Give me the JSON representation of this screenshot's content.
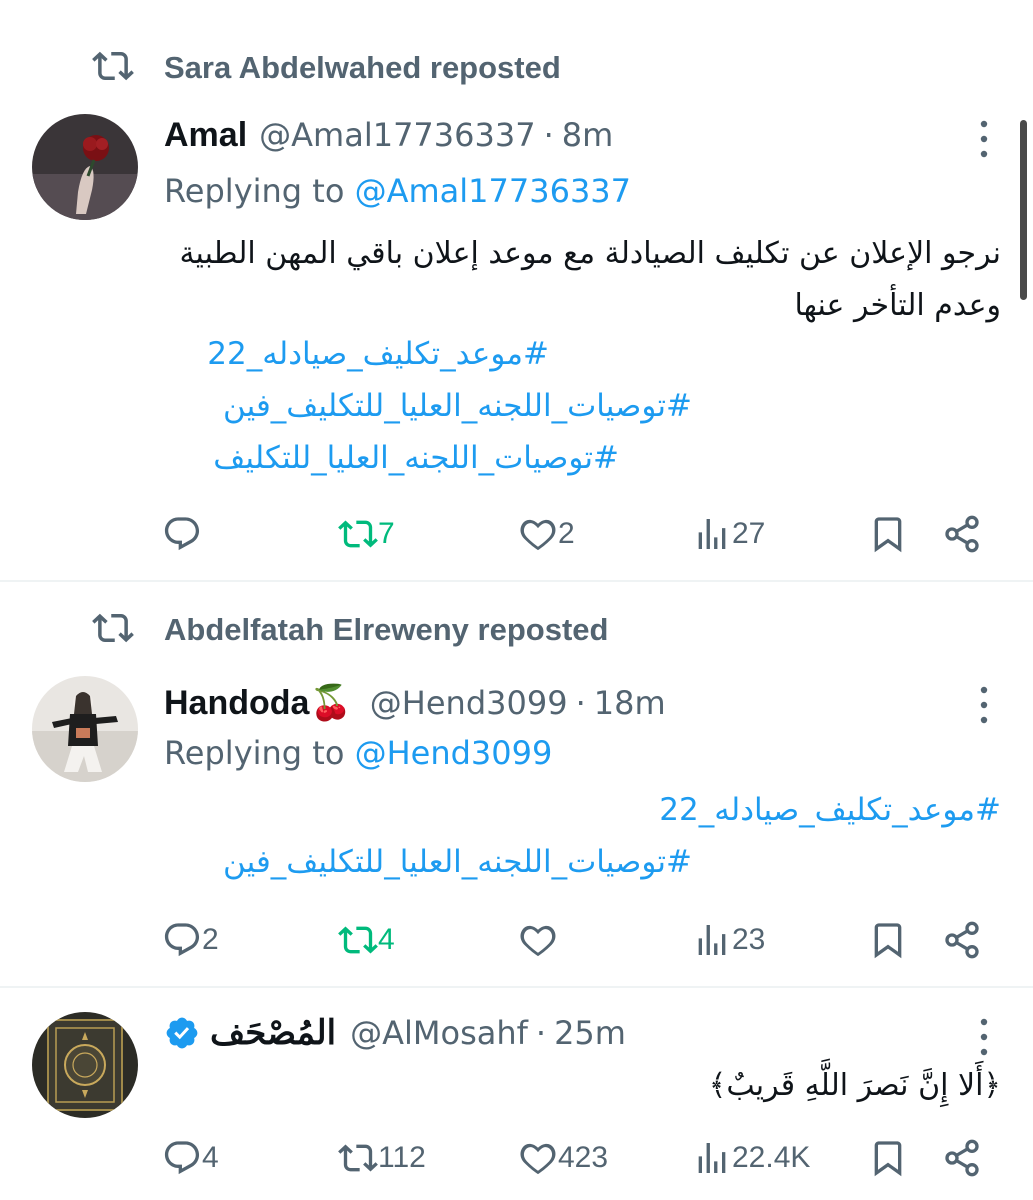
{
  "posts": [
    {
      "reposted_by": "Sara Abdelwahed reposted",
      "name": "Amal",
      "handle": "@Amal17736337",
      "separator": "·",
      "time": "8m",
      "replying_prefix": "Replying to ",
      "replying_handle": "@Amal17736337",
      "text": "نرجو الإعلان عن تكليف الصيادلة مع موعد إعلان باقي المهن الطبية وعدم التأخر عنها",
      "hashtags": [
        "#موعد_تكليف_صيادله_22",
        "#توصيات_اللجنه_العليا_للتكليف_فين",
        "#توصيات_اللجنه_العليا_للتكليف"
      ],
      "replies": "",
      "reposts": "7",
      "likes": "2",
      "views": "27"
    },
    {
      "reposted_by": "Abdelfatah Elreweny reposted",
      "name": "Handoda🍒",
      "handle": "@Hend3099",
      "separator": "·",
      "time": "18m",
      "replying_prefix": "Replying to ",
      "replying_handle": "@Hend3099",
      "hashtags": [
        "#موعد_تكليف_صيادله_22",
        "#توصيات_اللجنه_العليا_للتكليف_فين"
      ],
      "replies": "2",
      "reposts": "4",
      "likes": "",
      "views": "23"
    },
    {
      "name": "المُصْحَف",
      "verified": true,
      "handle": "@AlMosahf",
      "separator": "·",
      "time": "25m",
      "text": "﴿أَلا إِنَّ نَصرَ اللَّهِ قَريبٌ﴾",
      "replies": "4",
      "reposts": "112",
      "likes": "423",
      "views": "22.4K"
    }
  ],
  "colors": {
    "accent": "#1d9bf0",
    "secondary_text": "#536471",
    "repost_active": "#00ba7c",
    "divider": "#eff3f4"
  },
  "icons": [
    "repost-icon",
    "more-icon",
    "reply-icon",
    "like-icon",
    "views-icon",
    "bookmark-icon",
    "share-icon",
    "verified-icon"
  ]
}
